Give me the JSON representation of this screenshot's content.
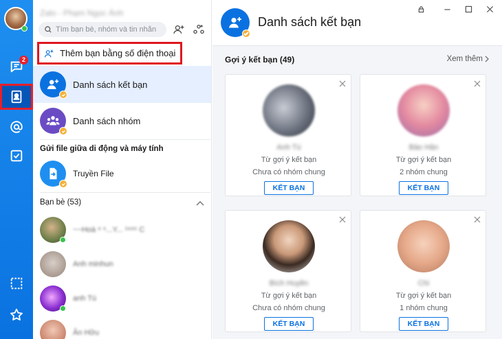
{
  "colors": {
    "brand": "#0a72e0",
    "highlight": "#e0161f",
    "online": "#36c34a"
  },
  "nav": {
    "messages_badge": "2",
    "items": [
      "message-icon",
      "contacts-icon",
      "mention-icon",
      "todo-icon",
      "screenshot-icon",
      "star-icon"
    ]
  },
  "panel": {
    "user_name": "Zalo - Phạm Ngọc Ánh",
    "search_placeholder": "Tìm bạn bè, nhóm và tin nhắn",
    "add_by_phone": "Thêm bạn bằng số điện thoại",
    "rows": {
      "friend_list": "Danh sách kết bạn",
      "group_list": "Danh sách nhóm"
    },
    "file_section": "Gửi file giữa di động và máy tính",
    "transfer_file": "Truyền File",
    "friends_section": "Bạn bè (53)",
    "friends": [
      {
        "name": "~~Hoà ⁹ ⁵...Y... ¹⁹⁹⁵ C",
        "online": true
      },
      {
        "name": "Anh minhun",
        "online": false
      },
      {
        "name": "anh Tú",
        "online": true
      },
      {
        "name": "Ân Hữu",
        "online": false
      }
    ]
  },
  "main": {
    "title": "Danh sách kết bạn",
    "suggestions_title": "Gợi ý kết bạn (49)",
    "see_more": "Xem thêm",
    "cards": [
      {
        "name": "Anh Tú",
        "line1": "Từ gợi ý kết bạn",
        "line2": "Chưa có nhóm chung",
        "button": "KẾT BẠN"
      },
      {
        "name": "Bảo Hân",
        "line1": "Từ gợi ý kết bạn",
        "line2": "2 nhóm chung",
        "button": "KẾT BẠN"
      },
      {
        "name": "Bích Huyền",
        "line1": "Từ gợi ý kết bạn",
        "line2": "Chưa có nhóm chung",
        "button": "KẾT BẠN"
      },
      {
        "name": "Chi",
        "line1": "Từ gợi ý kết bạn",
        "line2": "1 nhóm chung",
        "button": "KẾT BẠN"
      }
    ]
  }
}
